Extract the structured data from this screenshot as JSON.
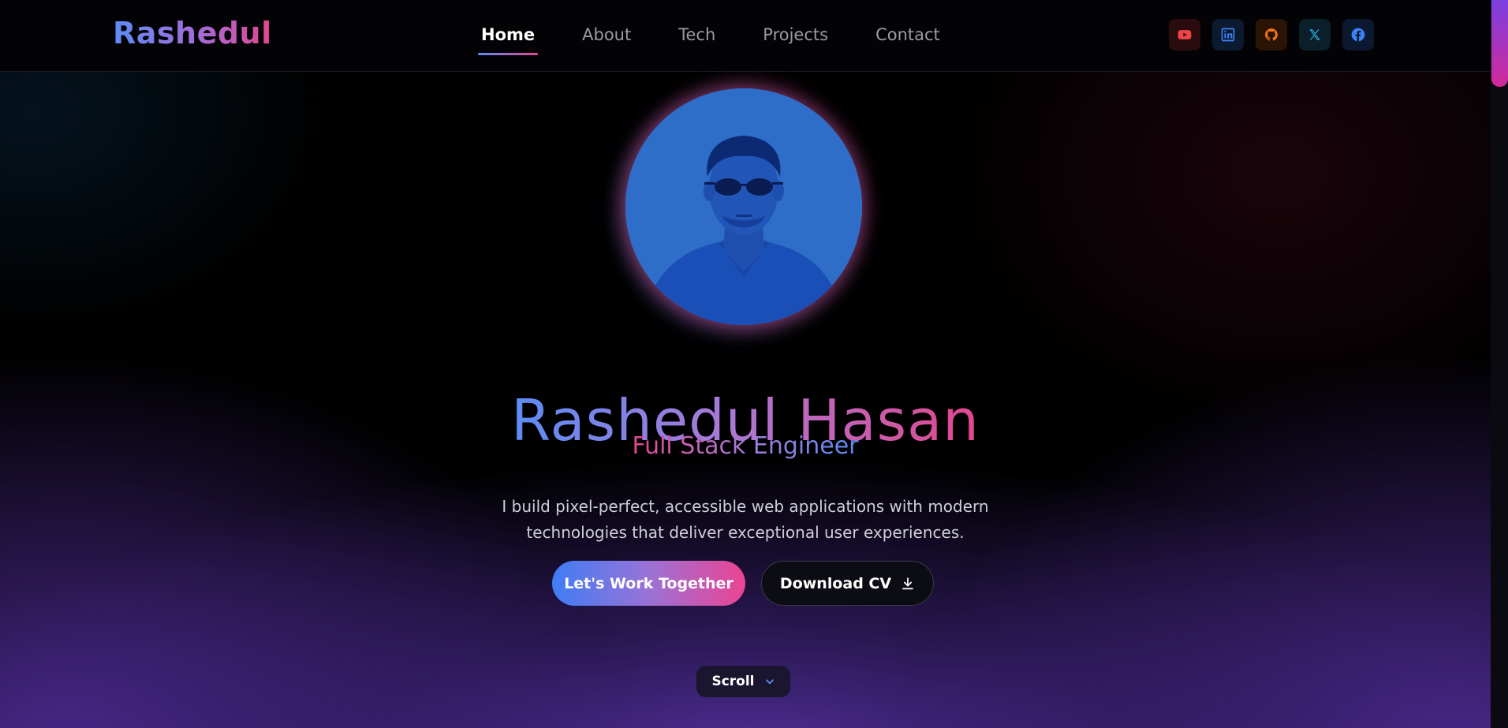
{
  "header": {
    "logo": "Rashedul",
    "nav": [
      {
        "label": "Home",
        "active": true
      },
      {
        "label": "About",
        "active": false
      },
      {
        "label": "Tech",
        "active": false
      },
      {
        "label": "Projects",
        "active": false
      },
      {
        "label": "Contact",
        "active": false
      }
    ],
    "socials": [
      {
        "icon": "youtube-icon",
        "color": "#ef4444"
      },
      {
        "icon": "linkedin-icon",
        "color": "#3b82f6"
      },
      {
        "icon": "github-icon",
        "color": "#f97316"
      },
      {
        "icon": "x-twitter-icon",
        "color": "#38bdf8"
      },
      {
        "icon": "facebook-icon",
        "color": "#3b82f6"
      }
    ]
  },
  "hero": {
    "name": "Rashedul Hasan",
    "role": "Full Stack Engineer",
    "description": "I build pixel-perfect, accessible web applications with modern technologies that deliver exceptional user experiences.",
    "primary_button": "Let's Work Together",
    "secondary_button": "Download CV",
    "scroll_label": "Scroll"
  },
  "colors": {
    "gradient_blue": "#5b8cf6",
    "gradient_pink": "#e2478d",
    "background": "#000000"
  }
}
